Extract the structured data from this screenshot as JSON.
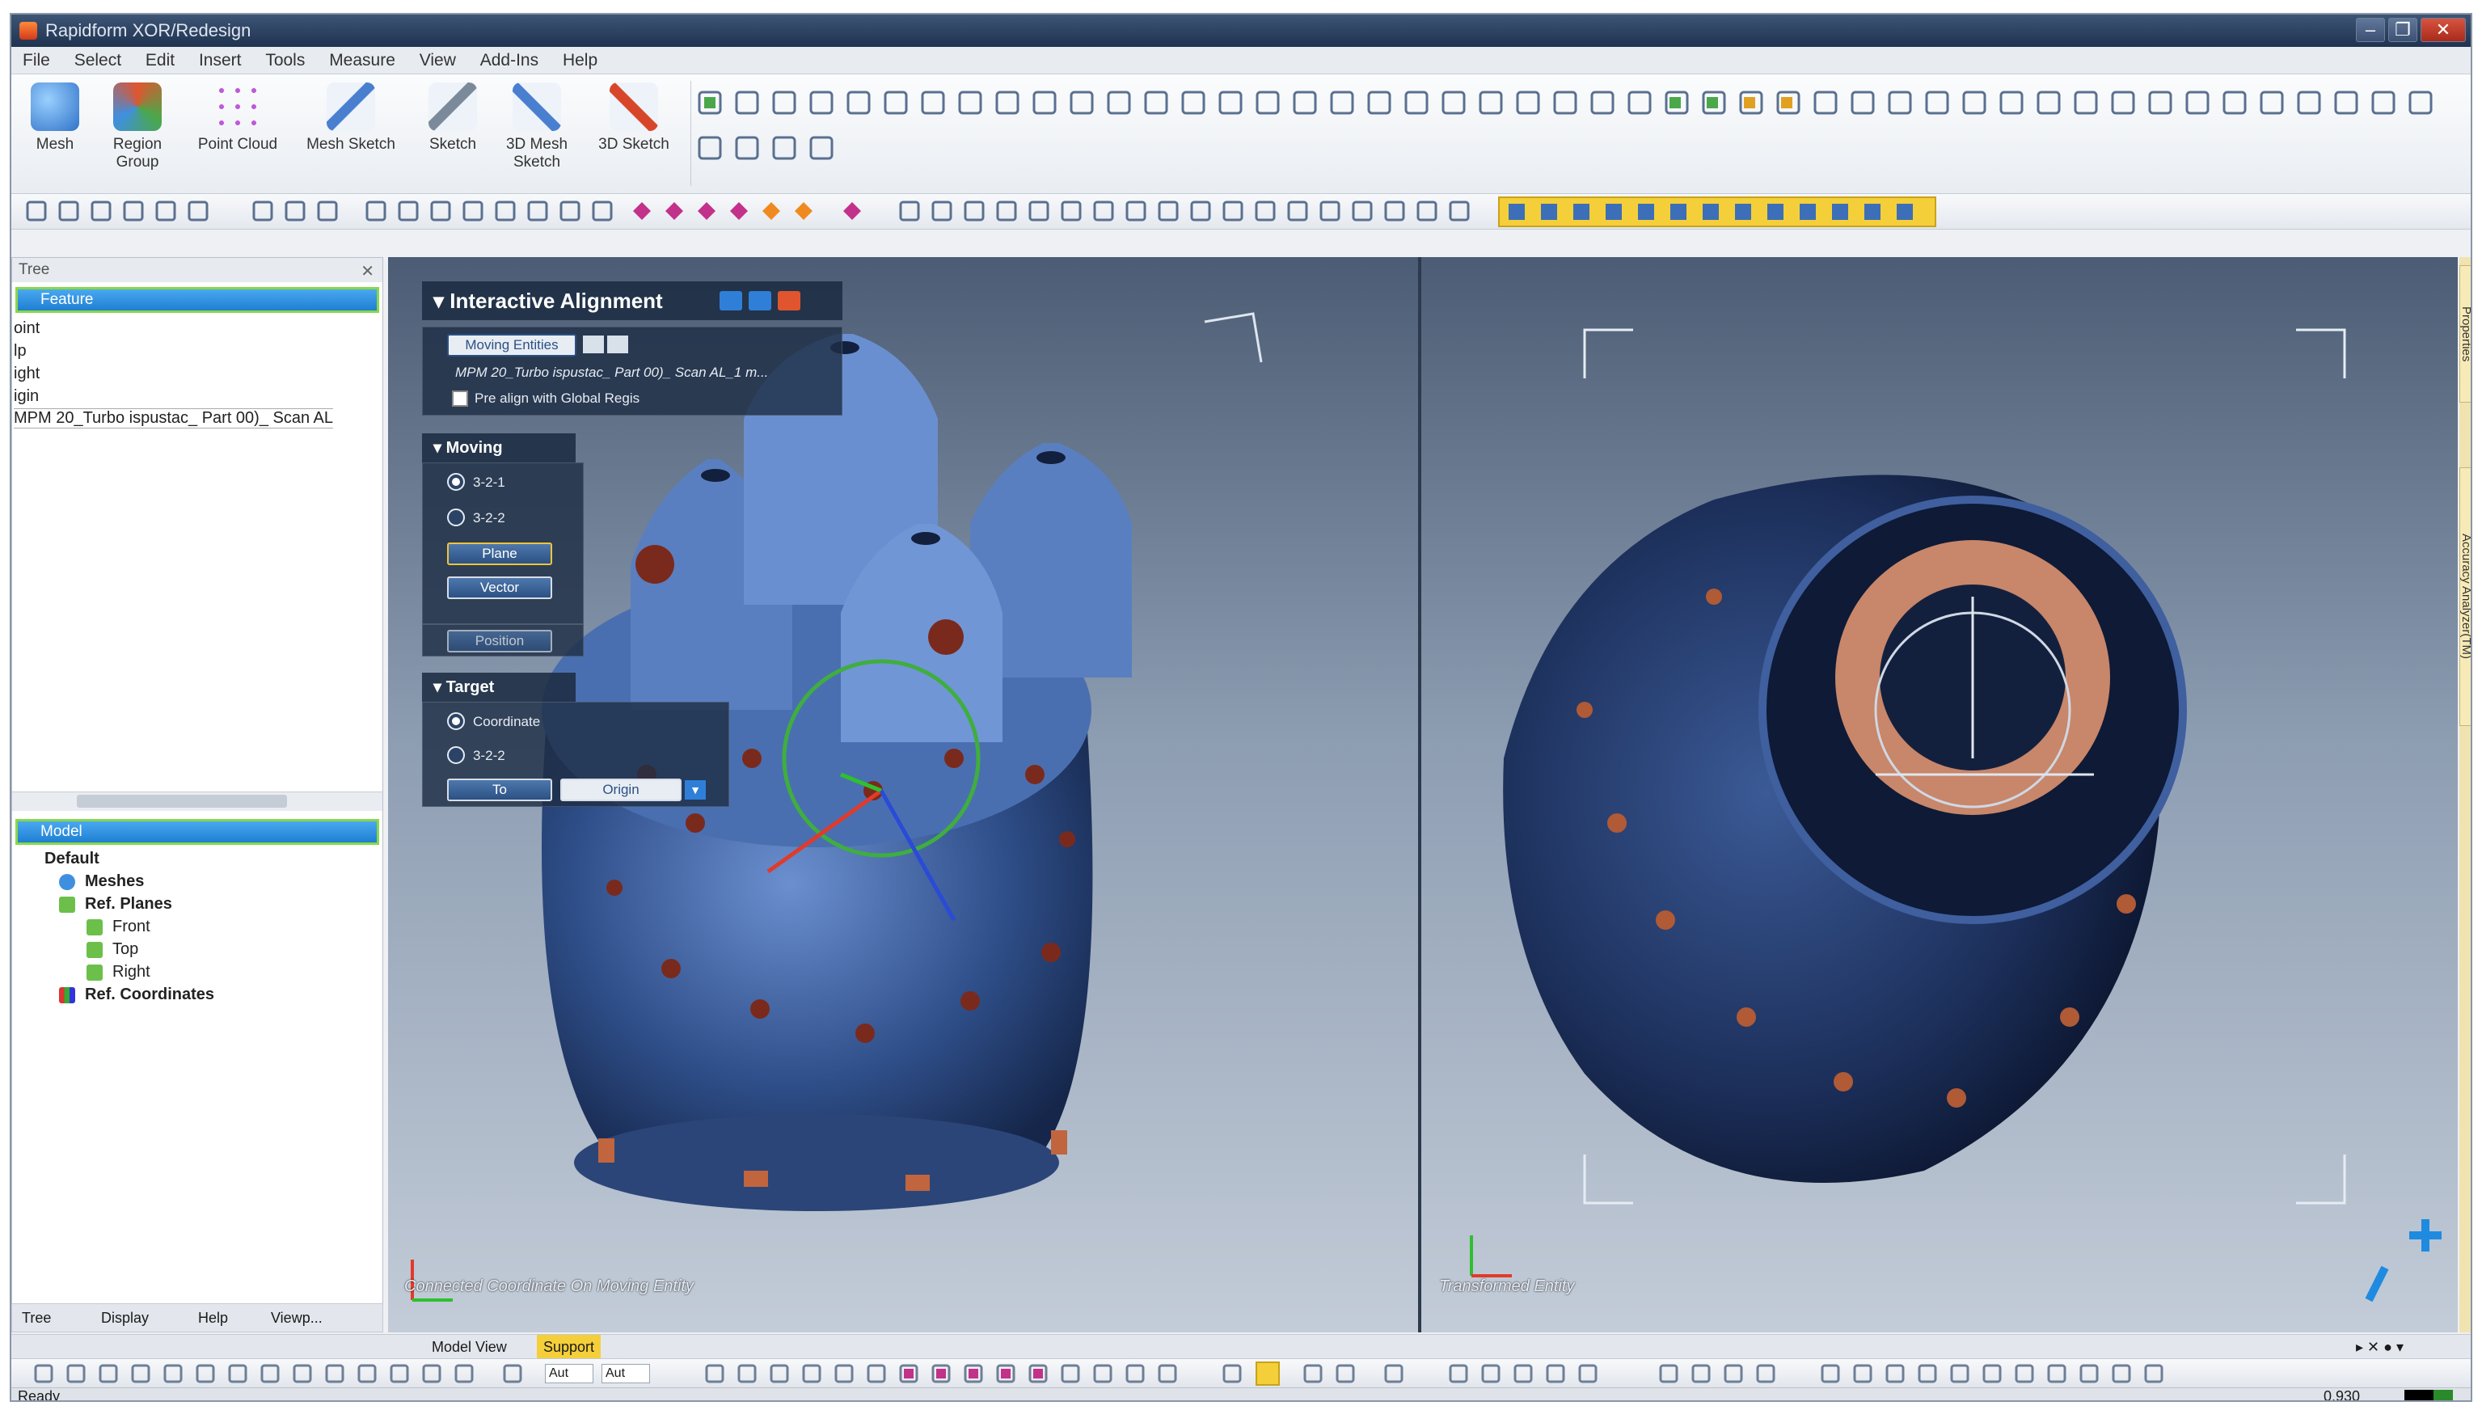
{
  "window": {
    "title": "Rapidform XOR/Redesign",
    "minimize_icon": "minimize-icon",
    "maximize_icon": "restore-icon",
    "close_label": "✕"
  },
  "menu": [
    "File",
    "Select",
    "Edit",
    "Insert",
    "Tools",
    "Measure",
    "View",
    "Add-Ins",
    "Help"
  ],
  "ribbon_buttons": [
    {
      "label": "Mesh",
      "icon": "mesh-icon",
      "color": "#3f8fe0"
    },
    {
      "label": "Region Group",
      "icon": "region-group-icon",
      "color": "#e0552e"
    },
    {
      "label": "Point Cloud",
      "icon": "point-cloud-icon",
      "color": "#c05ad8"
    },
    {
      "label": "Mesh Sketch",
      "icon": "mesh-sketch-icon",
      "color": "#4a7fd0"
    },
    {
      "label": "Sketch",
      "icon": "sketch-icon",
      "color": "#7a8a9a"
    },
    {
      "label": "3D Mesh Sketch",
      "icon": "3d-mesh-sketch-icon",
      "color": "#4a7fd0"
    },
    {
      "label": "3D Sketch",
      "icon": "3d-sketch-icon",
      "color": "#d8462a"
    }
  ],
  "tree_panel": {
    "header": "Tree",
    "feature_label": "Feature",
    "feature_items": [
      "oint",
      "lp",
      "ight",
      "igin",
      "MPM 20_Turbo ispustac_ Part 00)_ Scan AL"
    ],
    "model_label": "Model",
    "model_items": [
      {
        "label": "Default",
        "icon": "default-icon"
      },
      {
        "label": "Meshes",
        "icon": "meshes-icon"
      },
      {
        "label": "Ref. Planes",
        "icon": "ref-planes-icon"
      },
      {
        "label": "Front",
        "icon": "plane-icon"
      },
      {
        "label": "Top",
        "icon": "plane-icon"
      },
      {
        "label": "Right",
        "icon": "plane-icon"
      },
      {
        "label": "Ref. Coordinates",
        "icon": "ref-coordinates-icon"
      }
    ],
    "bottom_tabs": [
      "Tree",
      "Display",
      "Help",
      "Viewp..."
    ]
  },
  "alignment_panel": {
    "title": "Interactive Alignment",
    "moving_entities": "Moving Entities",
    "scan_name": "MPM 20_Turbo ispustac_ Part 00)_ Scan AL_1 m...",
    "prealign_label": "Pre align with Global Regis",
    "moving_header": "Moving",
    "moving_opt_1": "3-2-1",
    "moving_opt_2": "3-2-2",
    "plane_btn": "Plane",
    "vector_btn": "Vector",
    "position_btn": "Position",
    "target_header": "Target",
    "target_opt_1": "Coordinate",
    "target_opt_2": "3-2-2",
    "to_btn": "To",
    "origin_select": "Origin"
  },
  "viewport": {
    "left_overlay": "Connected Coordinate On Moving Entity",
    "right_overlay": "Transformed Entity",
    "background_top": "#4b5c74",
    "background_bottom": "#c3ccd8",
    "model_color": "#2f4f8a",
    "highlight_color": "#c8866a"
  },
  "right_dock": [
    "Properties",
    "Accuracy Analyzer(TM)"
  ],
  "model_tabs": [
    "Model View",
    "Support"
  ],
  "bottom_toolbar_values": {
    "dropdown_1": "Aut",
    "dropdown_2": "Aut"
  },
  "status": {
    "text": "Ready",
    "value": "0.930"
  }
}
